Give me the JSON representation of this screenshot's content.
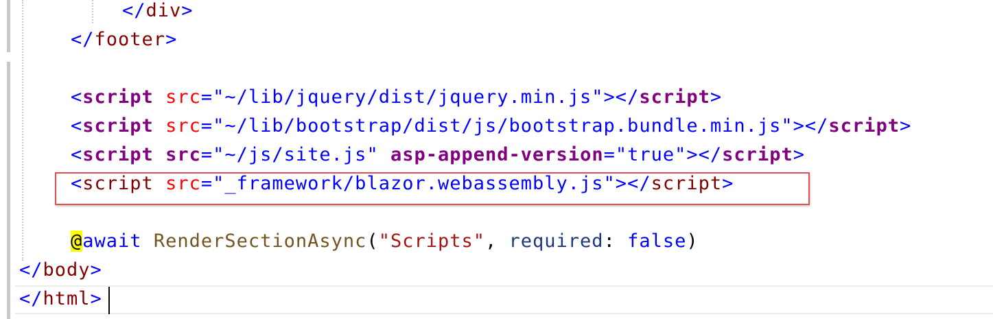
{
  "editor": {
    "lines": [
      {
        "id": "close-div",
        "tokens": [
          {
            "cls": "punc",
            "text": "</"
          },
          {
            "cls": "tag",
            "text": "div"
          },
          {
            "cls": "punc",
            "text": ">"
          }
        ]
      },
      {
        "id": "close-footer",
        "tokens": [
          {
            "cls": "punc",
            "text": "</"
          },
          {
            "cls": "tag",
            "text": "footer"
          },
          {
            "cls": "punc",
            "text": ">"
          }
        ]
      },
      {
        "id": "script-jquery",
        "tokens": [
          {
            "cls": "punc",
            "text": "<"
          },
          {
            "cls": "tagb",
            "text": "script"
          },
          {
            "cls": "ph",
            "text": " "
          },
          {
            "cls": "attr",
            "text": "src"
          },
          {
            "cls": "punc",
            "text": "=\""
          },
          {
            "cls": "val",
            "text": "~/lib/jquery/dist/jquery.min.js"
          },
          {
            "cls": "punc",
            "text": "\"></"
          },
          {
            "cls": "tagb",
            "text": "script"
          },
          {
            "cls": "punc",
            "text": ">"
          }
        ]
      },
      {
        "id": "script-bootstrap",
        "tokens": [
          {
            "cls": "punc",
            "text": "<"
          },
          {
            "cls": "tagb",
            "text": "script"
          },
          {
            "cls": "ph",
            "text": " "
          },
          {
            "cls": "attr",
            "text": "src"
          },
          {
            "cls": "punc",
            "text": "=\""
          },
          {
            "cls": "val",
            "text": "~/lib/bootstrap/dist/js/bootstrap.bundle.min.js"
          },
          {
            "cls": "punc",
            "text": "\"></"
          },
          {
            "cls": "tagb",
            "text": "script"
          },
          {
            "cls": "punc",
            "text": ">"
          }
        ]
      },
      {
        "id": "script-site",
        "tokens": [
          {
            "cls": "punc",
            "text": "<"
          },
          {
            "cls": "tagb",
            "text": "script"
          },
          {
            "cls": "ph",
            "text": " "
          },
          {
            "cls": "attrb",
            "text": "src"
          },
          {
            "cls": "punc",
            "text": "=\""
          },
          {
            "cls": "val",
            "text": "~/js/site.js"
          },
          {
            "cls": "punc",
            "text": "\""
          },
          {
            "cls": "ph",
            "text": " "
          },
          {
            "cls": "attrb",
            "text": "asp-append-version"
          },
          {
            "cls": "punc",
            "text": "=\""
          },
          {
            "cls": "val",
            "text": "true"
          },
          {
            "cls": "punc",
            "text": "\"></"
          },
          {
            "cls": "tagb",
            "text": "script"
          },
          {
            "cls": "punc",
            "text": ">"
          }
        ]
      },
      {
        "id": "script-blazor",
        "tokens": [
          {
            "cls": "punc",
            "text": "<"
          },
          {
            "cls": "tag",
            "text": "script"
          },
          {
            "cls": "ph",
            "text": " "
          },
          {
            "cls": "attr",
            "text": "src"
          },
          {
            "cls": "punc",
            "text": "=\""
          },
          {
            "cls": "val",
            "text": "_framework/blazor.webassembly.js"
          },
          {
            "cls": "punc",
            "text": "\"></"
          },
          {
            "cls": "tag",
            "text": "script"
          },
          {
            "cls": "punc",
            "text": ">"
          }
        ]
      },
      {
        "id": "render-section",
        "tokens": [
          {
            "cls": "at-sign",
            "text": "@"
          },
          {
            "cls": "kw",
            "text": "await"
          },
          {
            "cls": "ph",
            "text": " "
          },
          {
            "cls": "method",
            "text": "RenderSectionAsync"
          },
          {
            "cls": "ph",
            "text": "("
          },
          {
            "cls": "str",
            "text": "\"Scripts\""
          },
          {
            "cls": "ph",
            "text": ", "
          },
          {
            "cls": "param",
            "text": "required"
          },
          {
            "cls": "ph",
            "text": ": "
          },
          {
            "cls": "kw",
            "text": "false"
          },
          {
            "cls": "ph",
            "text": ")"
          }
        ]
      },
      {
        "id": "close-body",
        "tokens": [
          {
            "cls": "punc",
            "text": "</"
          },
          {
            "cls": "tag",
            "text": "body"
          },
          {
            "cls": "punc",
            "text": ">"
          }
        ]
      },
      {
        "id": "close-html",
        "tokens": [
          {
            "cls": "punc",
            "text": "</"
          },
          {
            "cls": "tag",
            "text": "html"
          },
          {
            "cls": "punc",
            "text": ">"
          }
        ]
      }
    ]
  }
}
